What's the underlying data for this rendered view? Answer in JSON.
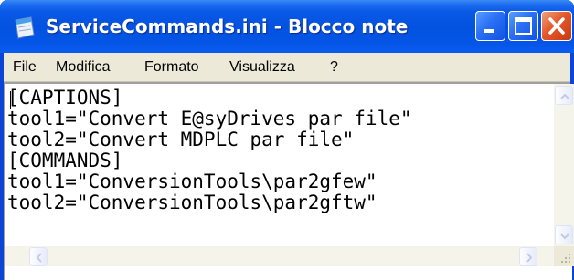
{
  "window": {
    "title": "ServiceCommands.ini - Blocco note",
    "app_icon": "notepad-icon",
    "controls": [
      "minimize-icon",
      "maximize-icon",
      "close-icon"
    ]
  },
  "menu": {
    "items": [
      {
        "label": "File"
      },
      {
        "label": "Modifica"
      },
      {
        "label": "Formato"
      },
      {
        "label": "Visualizza"
      },
      {
        "label": "?"
      }
    ]
  },
  "editor": {
    "lines": [
      "[CAPTIONS]",
      "tool1=\"Convert E@syDrives par file\"",
      "tool2=\"Convert MDPLC par file\"",
      "[COMMANDS]",
      "tool1=\"ConversionTools\\par2gfew\"",
      "tool2=\"ConversionTools\\par2gftw\""
    ]
  },
  "colors": {
    "titlebar": "#0452e0",
    "close_button": "#e4572a",
    "menubar": "#ece9d8",
    "editor_background": "#ffffff"
  }
}
